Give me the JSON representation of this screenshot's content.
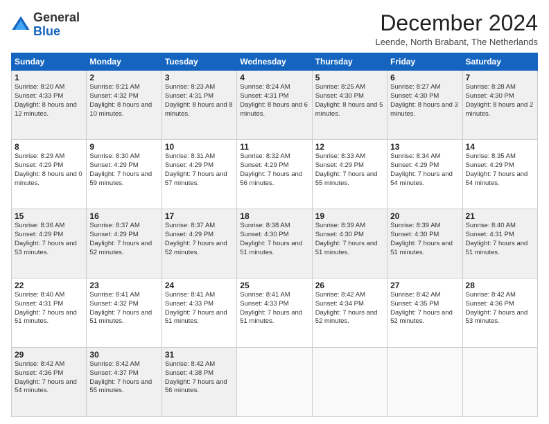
{
  "logo": {
    "general": "General",
    "blue": "Blue"
  },
  "header": {
    "month": "December 2024",
    "location": "Leende, North Brabant, The Netherlands"
  },
  "days_of_week": [
    "Sunday",
    "Monday",
    "Tuesday",
    "Wednesday",
    "Thursday",
    "Friday",
    "Saturday"
  ],
  "weeks": [
    [
      {
        "day": "1",
        "sunrise": "8:20 AM",
        "sunset": "4:33 PM",
        "daylight": "8 hours and 12 minutes."
      },
      {
        "day": "2",
        "sunrise": "8:21 AM",
        "sunset": "4:32 PM",
        "daylight": "8 hours and 10 minutes."
      },
      {
        "day": "3",
        "sunrise": "8:23 AM",
        "sunset": "4:31 PM",
        "daylight": "8 hours and 8 minutes."
      },
      {
        "day": "4",
        "sunrise": "8:24 AM",
        "sunset": "4:31 PM",
        "daylight": "8 hours and 6 minutes."
      },
      {
        "day": "5",
        "sunrise": "8:25 AM",
        "sunset": "4:30 PM",
        "daylight": "8 hours and 5 minutes."
      },
      {
        "day": "6",
        "sunrise": "8:27 AM",
        "sunset": "4:30 PM",
        "daylight": "8 hours and 3 minutes."
      },
      {
        "day": "7",
        "sunrise": "8:28 AM",
        "sunset": "4:30 PM",
        "daylight": "8 hours and 2 minutes."
      }
    ],
    [
      {
        "day": "8",
        "sunrise": "8:29 AM",
        "sunset": "4:29 PM",
        "daylight": "8 hours and 0 minutes."
      },
      {
        "day": "9",
        "sunrise": "8:30 AM",
        "sunset": "4:29 PM",
        "daylight": "7 hours and 59 minutes."
      },
      {
        "day": "10",
        "sunrise": "8:31 AM",
        "sunset": "4:29 PM",
        "daylight": "7 hours and 57 minutes."
      },
      {
        "day": "11",
        "sunrise": "8:32 AM",
        "sunset": "4:29 PM",
        "daylight": "7 hours and 56 minutes."
      },
      {
        "day": "12",
        "sunrise": "8:33 AM",
        "sunset": "4:29 PM",
        "daylight": "7 hours and 55 minutes."
      },
      {
        "day": "13",
        "sunrise": "8:34 AM",
        "sunset": "4:29 PM",
        "daylight": "7 hours and 54 minutes."
      },
      {
        "day": "14",
        "sunrise": "8:35 AM",
        "sunset": "4:29 PM",
        "daylight": "7 hours and 54 minutes."
      }
    ],
    [
      {
        "day": "15",
        "sunrise": "8:36 AM",
        "sunset": "4:29 PM",
        "daylight": "7 hours and 53 minutes."
      },
      {
        "day": "16",
        "sunrise": "8:37 AM",
        "sunset": "4:29 PM",
        "daylight": "7 hours and 52 minutes."
      },
      {
        "day": "17",
        "sunrise": "8:37 AM",
        "sunset": "4:29 PM",
        "daylight": "7 hours and 52 minutes."
      },
      {
        "day": "18",
        "sunrise": "8:38 AM",
        "sunset": "4:30 PM",
        "daylight": "7 hours and 51 minutes."
      },
      {
        "day": "19",
        "sunrise": "8:39 AM",
        "sunset": "4:30 PM",
        "daylight": "7 hours and 51 minutes."
      },
      {
        "day": "20",
        "sunrise": "8:39 AM",
        "sunset": "4:30 PM",
        "daylight": "7 hours and 51 minutes."
      },
      {
        "day": "21",
        "sunrise": "8:40 AM",
        "sunset": "4:31 PM",
        "daylight": "7 hours and 51 minutes."
      }
    ],
    [
      {
        "day": "22",
        "sunrise": "8:40 AM",
        "sunset": "4:31 PM",
        "daylight": "7 hours and 51 minutes."
      },
      {
        "day": "23",
        "sunrise": "8:41 AM",
        "sunset": "4:32 PM",
        "daylight": "7 hours and 51 minutes."
      },
      {
        "day": "24",
        "sunrise": "8:41 AM",
        "sunset": "4:33 PM",
        "daylight": "7 hours and 51 minutes."
      },
      {
        "day": "25",
        "sunrise": "8:41 AM",
        "sunset": "4:33 PM",
        "daylight": "7 hours and 51 minutes."
      },
      {
        "day": "26",
        "sunrise": "8:42 AM",
        "sunset": "4:34 PM",
        "daylight": "7 hours and 52 minutes."
      },
      {
        "day": "27",
        "sunrise": "8:42 AM",
        "sunset": "4:35 PM",
        "daylight": "7 hours and 52 minutes."
      },
      {
        "day": "28",
        "sunrise": "8:42 AM",
        "sunset": "4:36 PM",
        "daylight": "7 hours and 53 minutes."
      }
    ],
    [
      {
        "day": "29",
        "sunrise": "8:42 AM",
        "sunset": "4:36 PM",
        "daylight": "7 hours and 54 minutes."
      },
      {
        "day": "30",
        "sunrise": "8:42 AM",
        "sunset": "4:37 PM",
        "daylight": "7 hours and 55 minutes."
      },
      {
        "day": "31",
        "sunrise": "8:42 AM",
        "sunset": "4:38 PM",
        "daylight": "7 hours and 56 minutes."
      },
      null,
      null,
      null,
      null
    ]
  ]
}
